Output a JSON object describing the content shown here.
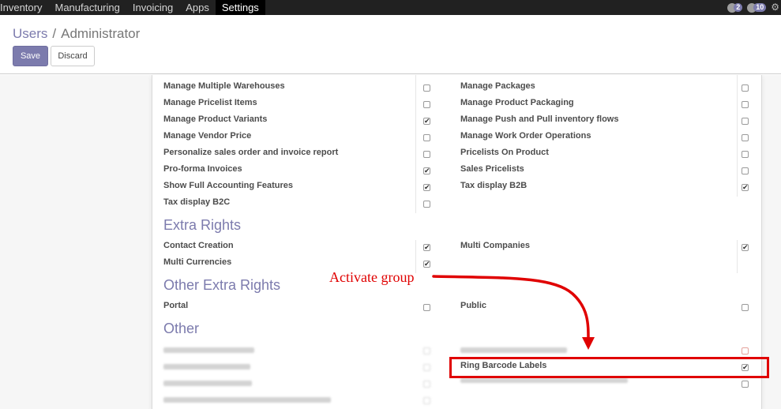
{
  "topbar": {
    "menu": [
      {
        "label": "Inventory",
        "active": false
      },
      {
        "label": "Manufacturing",
        "active": false
      },
      {
        "label": "Invoicing",
        "active": false
      },
      {
        "label": "Apps",
        "active": false
      },
      {
        "label": "Settings",
        "active": true
      }
    ],
    "systray": {
      "messages_count": "2",
      "activity_count": "10"
    }
  },
  "control_panel": {
    "breadcrumb": {
      "parent": "Users",
      "separator": "/",
      "current": "Administrator"
    },
    "save_label": "Save",
    "discard_label": "Discard"
  },
  "technical_settings": {
    "left": [
      {
        "label": "Manage Multiple Warehouses",
        "checked": false
      },
      {
        "label": "Manage Pricelist Items",
        "checked": false
      },
      {
        "label": "Manage Product Variants",
        "checked": true
      },
      {
        "label": "Manage Vendor Price",
        "checked": false
      },
      {
        "label": "Personalize sales order and invoice report",
        "checked": false
      },
      {
        "label": "Pro-forma Invoices",
        "checked": true
      },
      {
        "label": "Show Full Accounting Features",
        "checked": true
      },
      {
        "label": "Tax display B2C",
        "checked": false
      }
    ],
    "right": [
      {
        "label": "Manage Packages",
        "checked": false
      },
      {
        "label": "Manage Product Packaging",
        "checked": false
      },
      {
        "label": "Manage Push and Pull inventory flows",
        "checked": false
      },
      {
        "label": "Manage Work Order Operations",
        "checked": false
      },
      {
        "label": "Pricelists On Product",
        "checked": false
      },
      {
        "label": "Sales Pricelists",
        "checked": false
      },
      {
        "label": "Tax display B2B",
        "checked": true
      }
    ]
  },
  "extra_rights": {
    "title": "Extra Rights",
    "left": [
      {
        "label": "Contact Creation",
        "checked": true
      },
      {
        "label": "Multi Currencies",
        "checked": true
      }
    ],
    "right": [
      {
        "label": "Multi Companies",
        "checked": true
      }
    ]
  },
  "other_extra_rights": {
    "title": "Other Extra Rights",
    "left": [
      {
        "label": "Portal",
        "checked": false
      }
    ],
    "right": [
      {
        "label": "Public",
        "checked": false
      }
    ]
  },
  "other": {
    "title": "Other",
    "ring_barcode_labels": {
      "label": "Ring Barcode Labels",
      "checked": true
    }
  },
  "annotation": {
    "text": "Activate group",
    "color": "#e00000"
  },
  "colors": {
    "accent": "#7c7bad",
    "topbar": "#212121"
  }
}
